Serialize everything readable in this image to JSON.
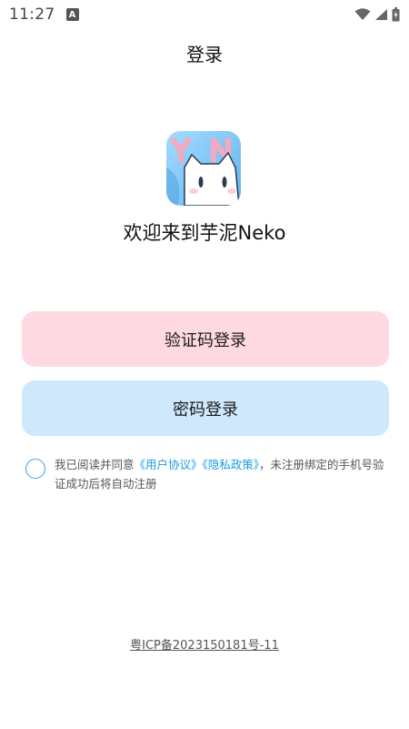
{
  "status_bar": {
    "time": "11:27",
    "icons": [
      "a-notification-icon",
      "wifi-icon",
      "signal-icon",
      "battery-icon"
    ]
  },
  "header": {
    "title": "登录"
  },
  "logo": {
    "letters": "YN",
    "alt": "芋泥Neko logo"
  },
  "welcome": {
    "text": "欢迎来到芋泥Neko"
  },
  "buttons": {
    "code_login": "验证码登录",
    "password_login": "密码登录"
  },
  "agreement": {
    "prefix": "我已阅读并同意",
    "user_agreement": "《用户协议》",
    "privacy_policy": "《隐私政策》",
    "suffix": "，未注册绑定的手机号验证成功后将自动注册",
    "checked": false
  },
  "footer": {
    "icp": "粤ICP备2023150181号-11"
  },
  "colors": {
    "code_button_bg": "#ffd9e2",
    "password_button_bg": "#d0e8fc",
    "link": "#1d9be0",
    "radio_border": "#3aa3e8"
  }
}
